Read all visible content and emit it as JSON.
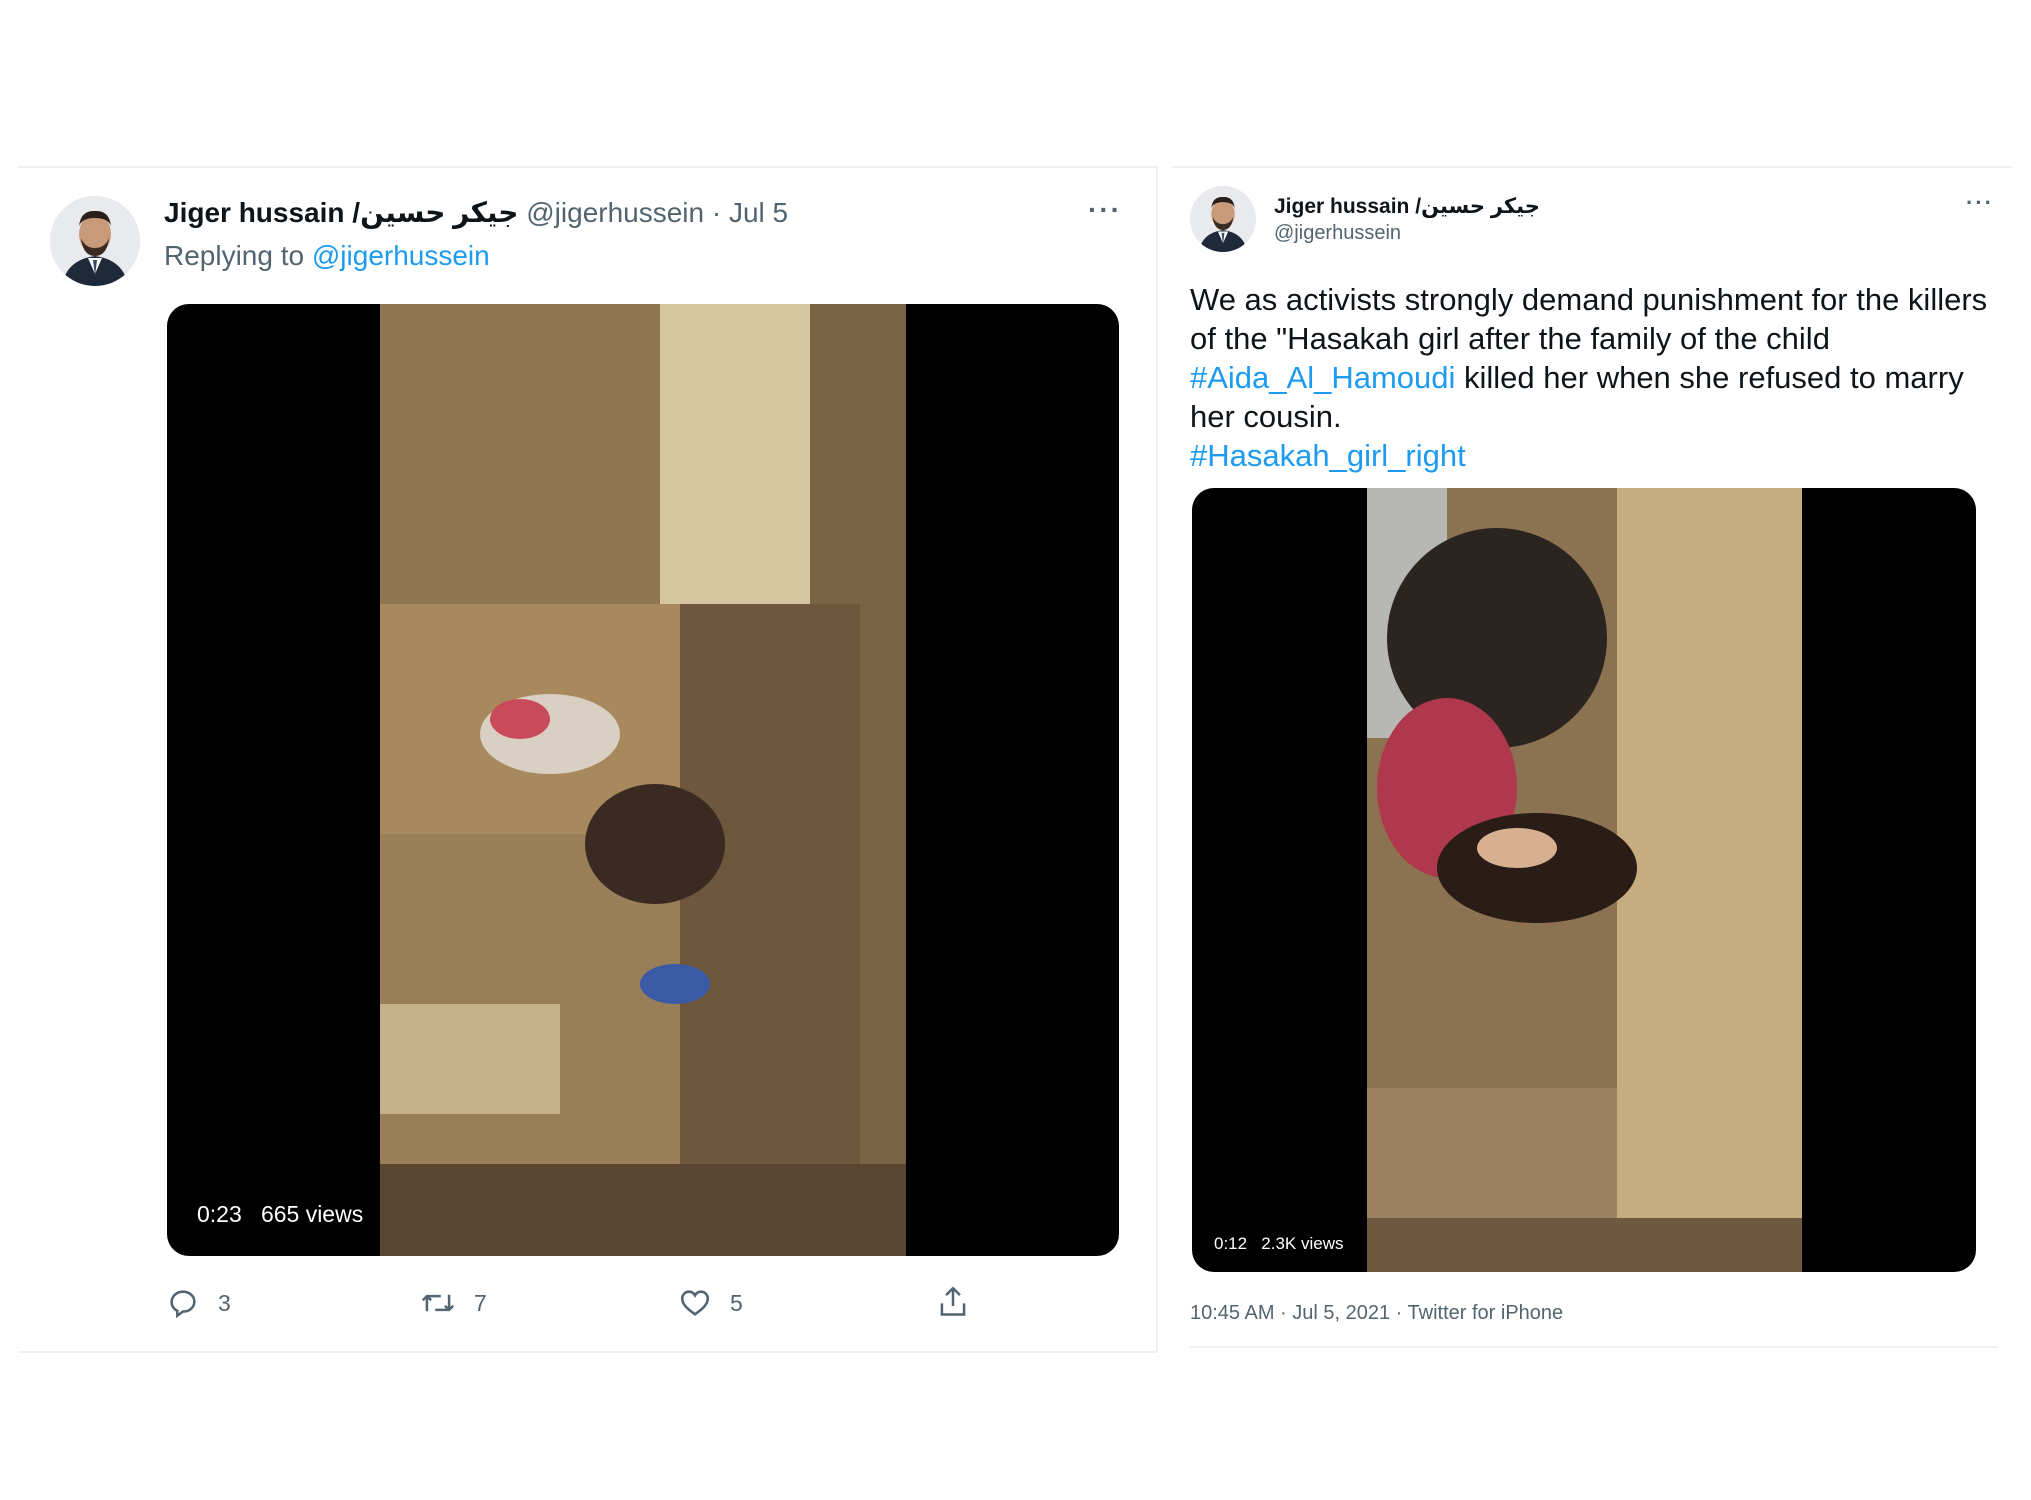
{
  "tweet_left": {
    "display_name": "Jiger hussain /جيكر حسين",
    "handle": "@jigerhussein",
    "date_separator": " · ",
    "date": "Jul 5",
    "replying_prefix": "Replying to ",
    "replying_handle": "@jigerhussein",
    "more_label": "···",
    "video": {
      "duration": "0:23",
      "views": "665 views"
    },
    "actions": {
      "replies": "3",
      "retweets": "7",
      "likes": "5"
    }
  },
  "tweet_right": {
    "display_name": "Jiger hussain /جيكر حسين",
    "handle": "@jigerhussein",
    "more_label": "···",
    "text": {
      "part1": "We as activists strongly demand punishment for the killers of the \"Hasakah girl after the family of the child ",
      "hashtag1": "#Aida_Al_Hamoudi",
      "part2": " killed her when she refused to marry her cousin.",
      "hashtag2": "#Hasakah_girl_right"
    },
    "video": {
      "duration": "0:12",
      "views": "2.3K views"
    },
    "timestamp": "10:45 AM · Jul 5, 2021 · Twitter for iPhone"
  },
  "colors": {
    "link": "#1d9bf0",
    "muted": "#536471",
    "border": "#eef0f2"
  },
  "icons": [
    "user-avatar",
    "more-icon",
    "reply-icon",
    "retweet-icon",
    "like-icon",
    "share-icon"
  ]
}
